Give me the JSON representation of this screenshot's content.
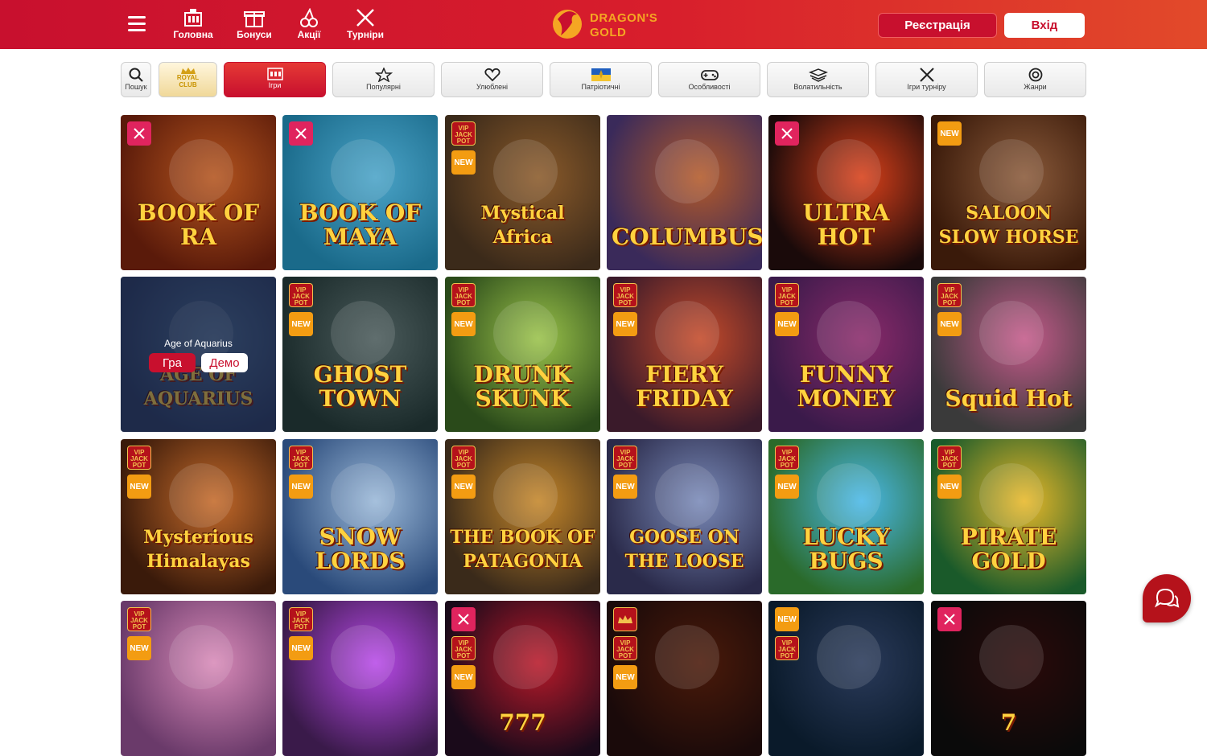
{
  "header": {
    "nav": [
      {
        "label": "Головна",
        "icon": "home-icon"
      },
      {
        "label": "Бонуси",
        "icon": "gift-icon"
      },
      {
        "label": "Акції",
        "icon": "cherries-icon"
      },
      {
        "label": "Турніри",
        "icon": "crossed-swords-icon"
      }
    ],
    "logo_line1": "DRAGON'S",
    "logo_line2": "GOLD",
    "register_label": "Реєстрація",
    "login_label": "Вхід",
    "brand_color": "#c8102e",
    "logo_color": "#f5a623"
  },
  "categories": {
    "search": "Пошук",
    "royal_line1": "ROYAL",
    "royal_line2": "CLUB",
    "items": [
      {
        "label": "Ігри",
        "icon": "slot-machine-icon",
        "active": true
      },
      {
        "label": "Популярні",
        "icon": "star-icon"
      },
      {
        "label": "Улюблені",
        "icon": "heart-icon"
      },
      {
        "label": "Патріотичні",
        "icon": "ukraine-flag-icon"
      },
      {
        "label": "Особливості",
        "icon": "gamepad-icon"
      },
      {
        "label": "Волатильність",
        "icon": "volatility-icon"
      },
      {
        "label": "Ігри турніру",
        "icon": "crossed-swords-icon"
      },
      {
        "label": "Жанри",
        "icon": "genres-icon"
      }
    ]
  },
  "games": [
    {
      "title": "BOOK OF RA",
      "badges": [
        "tournament"
      ]
    },
    {
      "title": "BOOK OF MAYA",
      "badges": [
        "tournament"
      ]
    },
    {
      "title": "Mystical Africa",
      "badges": [
        "vip",
        "new"
      ]
    },
    {
      "title": "COLUMBUS",
      "badges": []
    },
    {
      "title": "ULTRA HOT",
      "badges": [
        "tournament"
      ]
    },
    {
      "title": "SALOON SLOW HORSE",
      "badges": [
        "new"
      ]
    },
    {
      "title": "AGE OF AQUARIUS",
      "badges": [],
      "hover": true,
      "hover_title": "Age of Aquarius",
      "play": "Гра",
      "demo": "Демо"
    },
    {
      "title": "GHOST TOWN",
      "badges": [
        "vip",
        "new"
      ]
    },
    {
      "title": "DRUNK SKUNK",
      "badges": [
        "vip",
        "new"
      ]
    },
    {
      "title": "FIERY FRIDAY",
      "badges": [
        "vip",
        "new"
      ]
    },
    {
      "title": "FUNNY MONEY",
      "badges": [
        "vip",
        "new"
      ]
    },
    {
      "title": "Squid Hot",
      "badges": [
        "vip",
        "new"
      ]
    },
    {
      "title": "Mysterious Himalayas",
      "badges": [
        "vip",
        "new"
      ]
    },
    {
      "title": "SNOW LORDS",
      "badges": [
        "vip",
        "new"
      ]
    },
    {
      "title": "THE BOOK OF PATAGONIA",
      "badges": [
        "vip",
        "new"
      ]
    },
    {
      "title": "GOOSE ON THE LOOSE",
      "badges": [
        "vip",
        "new"
      ]
    },
    {
      "title": "LUCKY BUGS",
      "badges": [
        "vip",
        "new"
      ]
    },
    {
      "title": "PIRATE GOLD",
      "badges": [
        "vip",
        "new"
      ]
    },
    {
      "title": "",
      "badges": [
        "vip",
        "new"
      ]
    },
    {
      "title": "",
      "badges": [
        "vip",
        "new"
      ]
    },
    {
      "title": "777",
      "badges": [
        "tournament",
        "vip",
        "new"
      ]
    },
    {
      "title": "",
      "badges": [
        "crown",
        "vip",
        "new"
      ]
    },
    {
      "title": "",
      "badges": [
        "new",
        "vip"
      ]
    },
    {
      "title": "7",
      "badges": [
        "tournament"
      ]
    }
  ],
  "badge_labels": {
    "vip": "VIP JACK POT",
    "new": "NEW"
  },
  "chat_icon": "chat-icon"
}
